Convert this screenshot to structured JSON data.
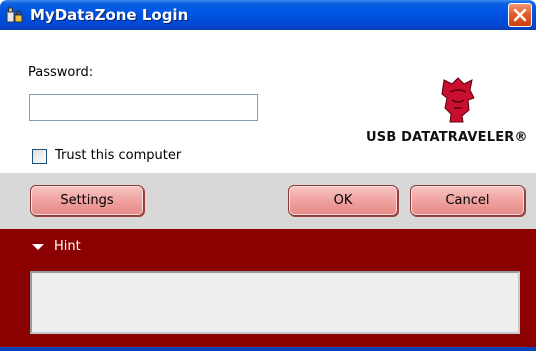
{
  "window": {
    "title": "MyDataZone Login"
  },
  "form": {
    "password_label": "Password:",
    "password_value": "",
    "trust_label": "Trust this computer",
    "trust_checked": false
  },
  "logo": {
    "text": "USB DATATRAVELER®"
  },
  "buttons": {
    "settings": "Settings",
    "ok": "OK",
    "cancel": "Cancel"
  },
  "hint": {
    "label": "Hint",
    "text": ""
  },
  "icons": {
    "app": "usb-lock-icon",
    "close": "close-icon",
    "hint_toggle": "triangle-down-icon",
    "logo": "kingston-head-logo"
  },
  "colors": {
    "title_bar": "#0055e5",
    "hint_panel": "#8b0000",
    "button": "#ef9f9c",
    "button_bar": "#d8d8d8",
    "close_button": "#e35d2b"
  }
}
